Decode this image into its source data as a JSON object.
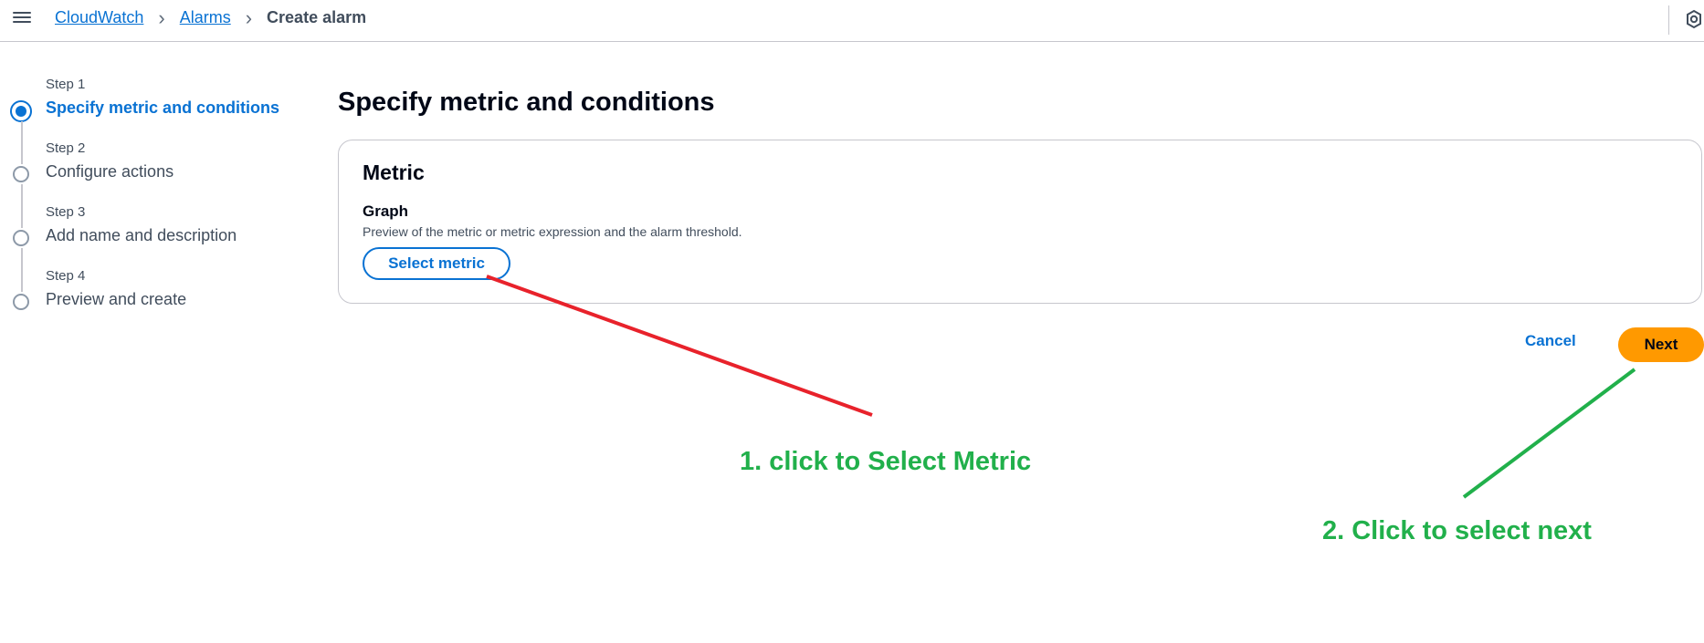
{
  "breadcrumb": {
    "items": [
      "CloudWatch",
      "Alarms"
    ],
    "current": "Create alarm"
  },
  "steps": [
    {
      "number": "Step 1",
      "title": "Specify metric and conditions",
      "active": true
    },
    {
      "number": "Step 2",
      "title": "Configure actions",
      "active": false
    },
    {
      "number": "Step 3",
      "title": "Add name and description",
      "active": false
    },
    {
      "number": "Step 4",
      "title": "Preview and create",
      "active": false
    }
  ],
  "main": {
    "title": "Specify metric and conditions",
    "card": {
      "title": "Metric",
      "graph_label": "Graph",
      "graph_description": "Preview of the metric or metric expression and the alarm threshold.",
      "select_metric_label": "Select metric"
    },
    "cancel_label": "Cancel",
    "next_label": "Next"
  },
  "annotations": {
    "note1": "1. click to Select Metric",
    "note2": "2. Click to select next"
  },
  "colors": {
    "accent": "#0972d3",
    "primary_button": "#ff9900",
    "annotation_red": "#e8222b",
    "annotation_green": "#21b04b"
  }
}
